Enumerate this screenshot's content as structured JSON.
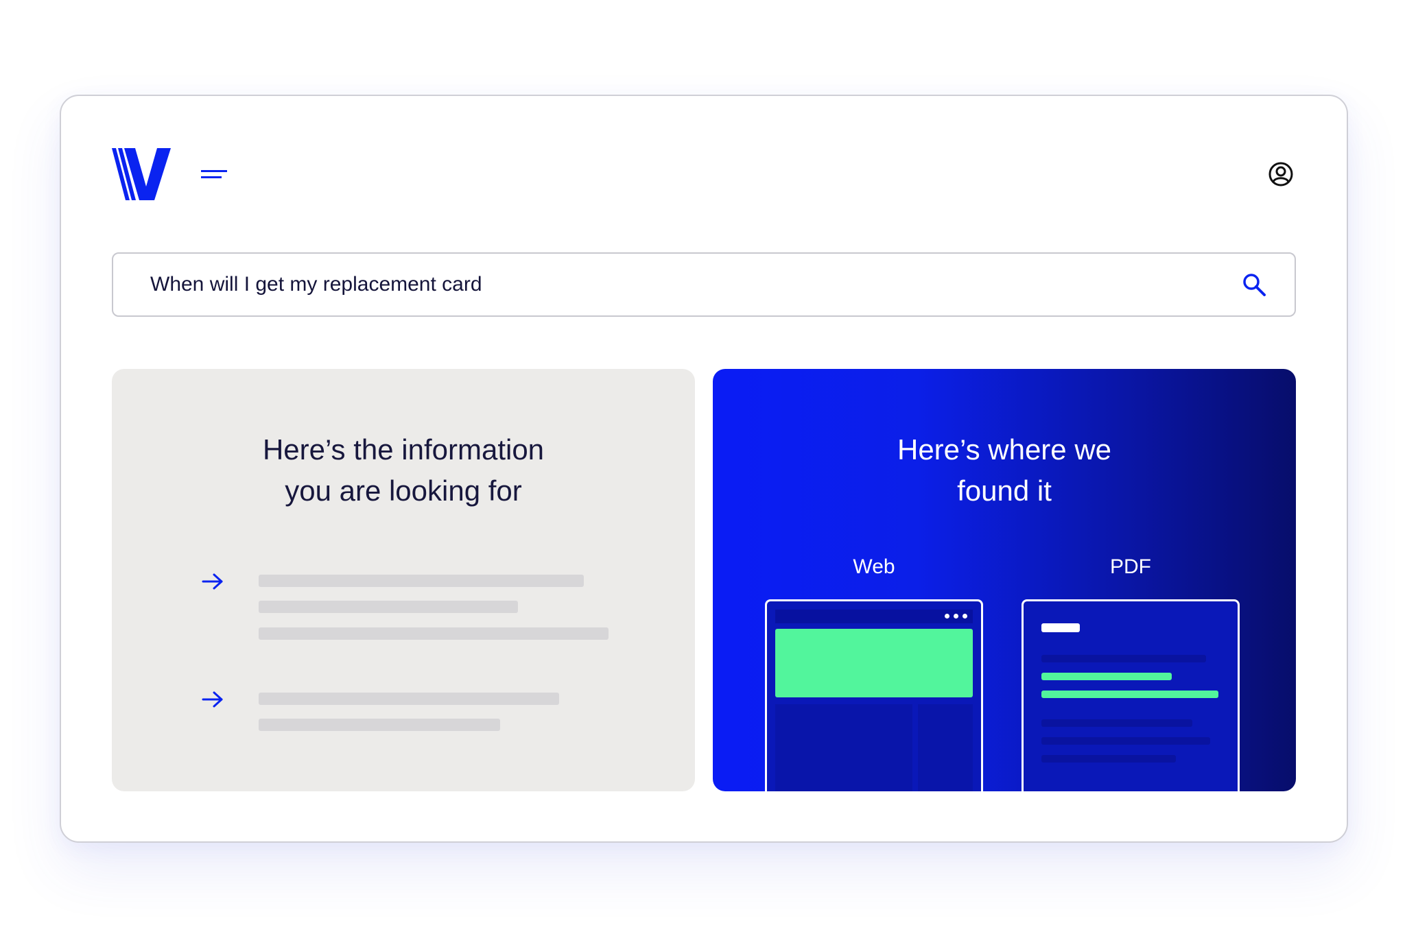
{
  "search": {
    "value": "When will I get my replacement card"
  },
  "results": {
    "left_title_line1": "Here’s the information",
    "left_title_line2": "you are looking for",
    "right_title_line1": "Here’s where we",
    "right_title_line2": "found it",
    "sources": {
      "web_label": "Web",
      "pdf_label": "PDF"
    }
  },
  "colors": {
    "brand_blue": "#0a23f0",
    "accent_green": "#52f59c",
    "text_dark": "#17173d",
    "card_gray": "#ecebe9"
  },
  "icons": {
    "logo": "v-logo",
    "menu": "menu-icon",
    "user": "user-circle-icon",
    "search": "search-icon",
    "arrow": "arrow-right-icon"
  }
}
